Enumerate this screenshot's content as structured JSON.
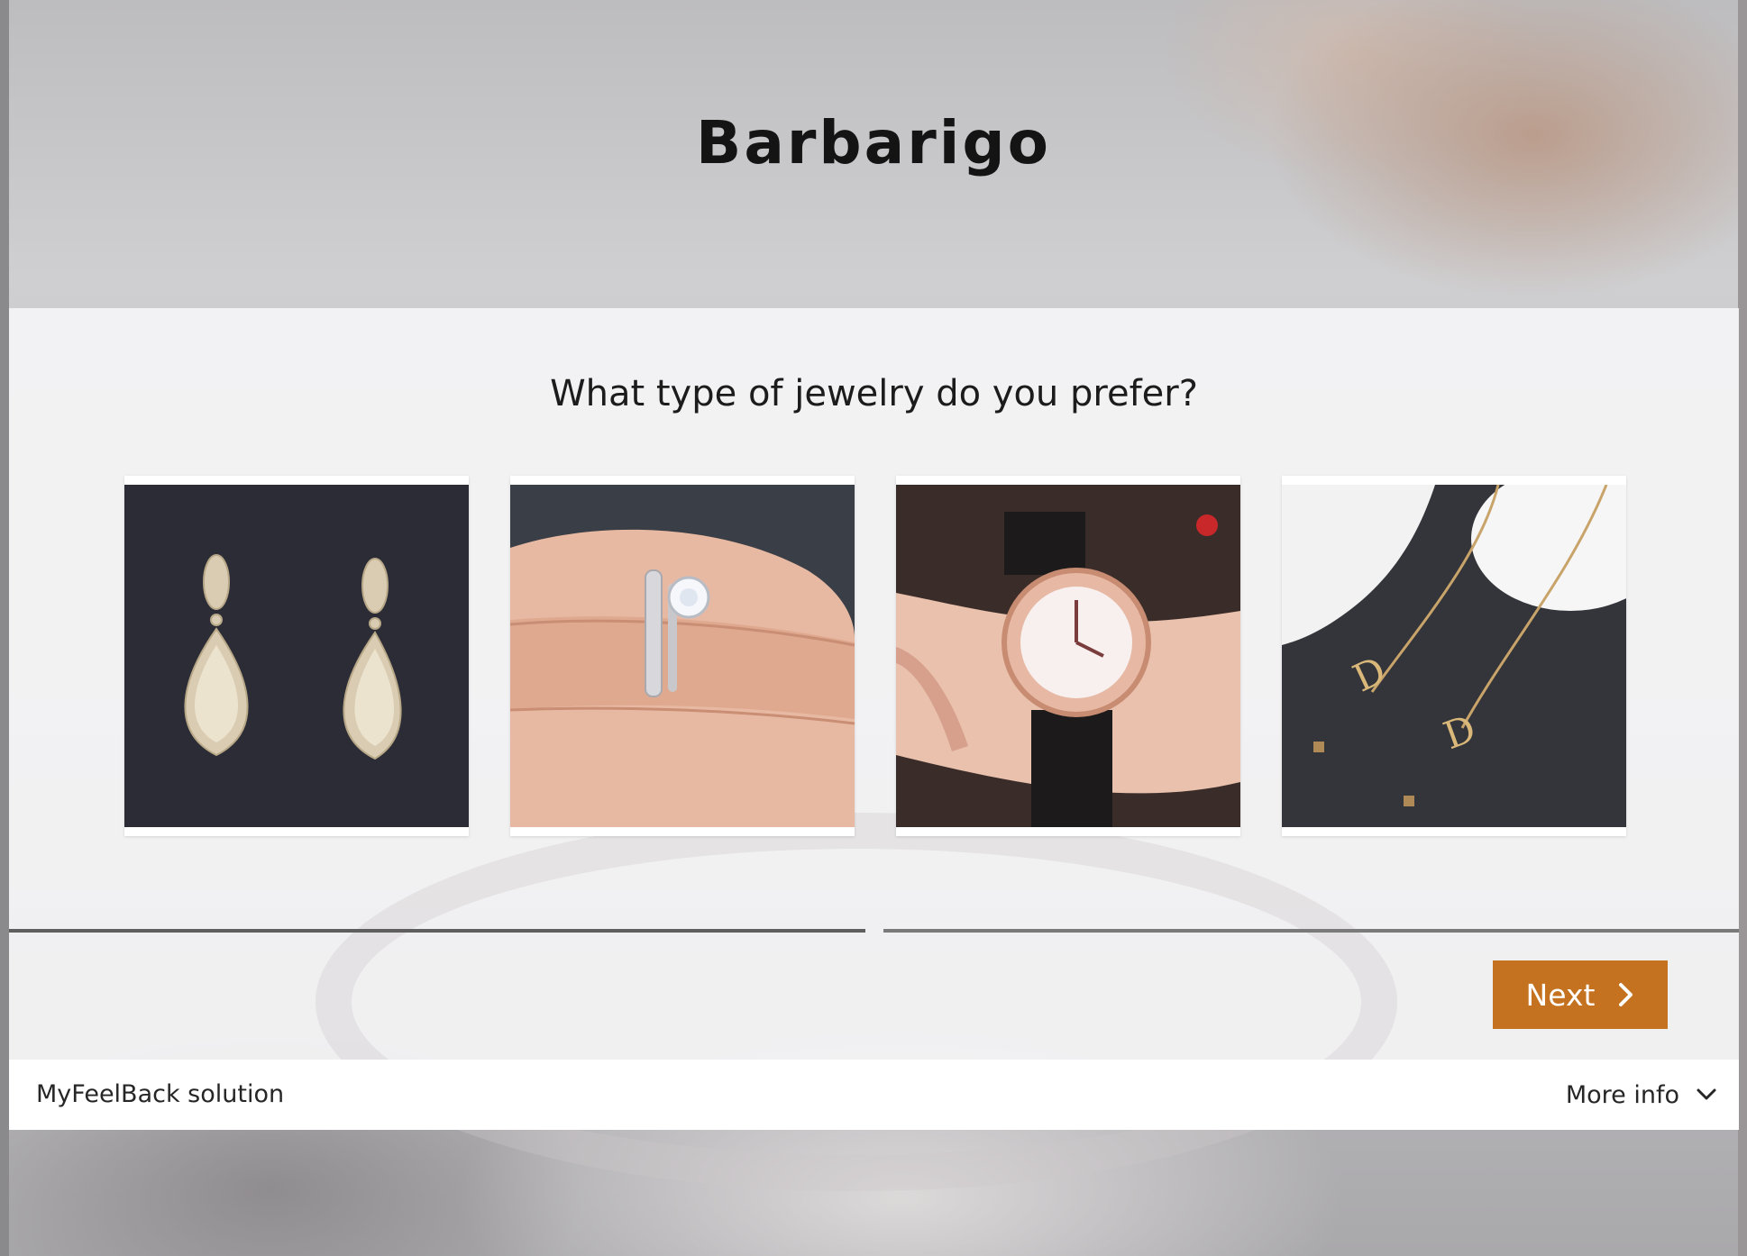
{
  "brand": {
    "name": "Barbarigo"
  },
  "question": {
    "text": "What type of jewelry do you prefer?"
  },
  "options": [
    {
      "icon": "earrings-image"
    },
    {
      "icon": "ring-image"
    },
    {
      "icon": "watch-image"
    },
    {
      "icon": "necklace-image"
    }
  ],
  "progress": {
    "value": 0.5
  },
  "actions": {
    "next_label": "Next"
  },
  "footer": {
    "solution_label": "MyFeelBack solution",
    "more_info_label": "More info"
  },
  "colors": {
    "accent": "#c4721f",
    "panel": "#f6f6f7",
    "text": "#1c1c1c"
  }
}
